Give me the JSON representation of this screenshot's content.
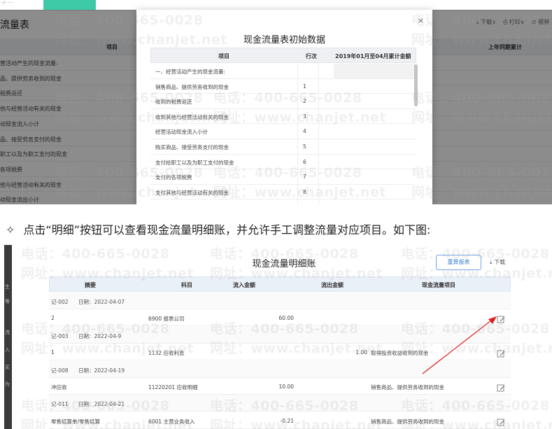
{
  "top": {
    "tab_label": "··/······",
    "app_title": "流量表",
    "toolbar": [
      "下载∨",
      "打印∨",
      "视频"
    ],
    "headers": {
      "item": "项目",
      "prev": "上年同期累计"
    },
    "rows": [
      "营活动产生的现金流量:",
      "品、提供劳务收到的现金",
      "税费返还",
      "他与经营活动有关的现金",
      "动现金流入小计",
      "品、接受劳务支付的现金",
      "职工以及为职工支付的现金",
      "各项税费",
      "他与经营活动有关的现金",
      "动现金流出小计"
    ],
    "modal": {
      "title": "现金流量表初始数据",
      "close": "×",
      "headers": {
        "item": "项目",
        "line": "行次",
        "amount": "2019年01月至04月累计金额"
      },
      "rows": [
        {
          "item": "一、经营活动产生的现金流量:",
          "line": ""
        },
        {
          "item": "销售商品、提供劳务收到的现金",
          "line": "1"
        },
        {
          "item": "收到的税费返还",
          "line": "2"
        },
        {
          "item": "收到其他与经营活动有关的现金",
          "line": "3"
        },
        {
          "item": "经营活动现金流入小计",
          "line": "4"
        },
        {
          "item": "购买商品、接受劳务支付的现金",
          "line": "5"
        },
        {
          "item": "支付给职工以及为职工支付的现金",
          "line": "6"
        },
        {
          "item": "支付的各项税费",
          "line": "7"
        },
        {
          "item": "支付其他与经营活动有关的现金",
          "line": "8"
        }
      ]
    }
  },
  "instruction": {
    "symbol": "✧",
    "text": "点击“明细”按钮可以查看现金流量明细账，并允许手工调整流量对应项目。如下图:"
  },
  "bottom": {
    "title": "现金流量明细账",
    "redo_button": "重算报表",
    "download": "下载",
    "side_labels": [
      "生",
      "等",
      "流",
      "入",
      "买",
      "为"
    ],
    "headers": {
      "summary": "摘要",
      "subject": "科目",
      "inflow": "流入金额",
      "outflow": "流出金额",
      "item": "现金流量项目"
    },
    "rows": [
      {
        "group": true,
        "voucher": "记-002",
        "date": "日期：2022-04-07"
      },
      {
        "group": false,
        "summary": "2",
        "subject": "6900 报表公司",
        "inflow": "60.00",
        "outflow": "",
        "item": ""
      },
      {
        "group": true,
        "voucher": "记-003",
        "date": "日期：2022-04-9"
      },
      {
        "group": false,
        "summary": "1",
        "subject": "1132 应收利息",
        "inflow": "",
        "outflow": "1.00",
        "item": "取得投资收益收到的现金"
      },
      {
        "group": true,
        "voucher": "记-008",
        "date": "日期：2022-04-19"
      },
      {
        "group": false,
        "summary": "冲应收",
        "subject": "11220201 应收明细",
        "inflow": "10.00",
        "outflow": "",
        "item": "销售商品、提供劳务收到的现金"
      },
      {
        "group": true,
        "voucher": "记-011",
        "date": "日期：2022-04-21"
      },
      {
        "group": false,
        "summary": "零售结算单/零售结算",
        "subject": "6001 主营业务收入",
        "inflow": "-0.21",
        "outflow": "",
        "item": "销售商品、提供劳务收到的现金"
      }
    ]
  },
  "watermark": {
    "phone": "电话：400-665-0028",
    "site": "网址：www.chanjet.net"
  },
  "colors": {
    "accent": "#3ec9a7",
    "arrow": "#e02020",
    "link": "#3d7fd6"
  }
}
